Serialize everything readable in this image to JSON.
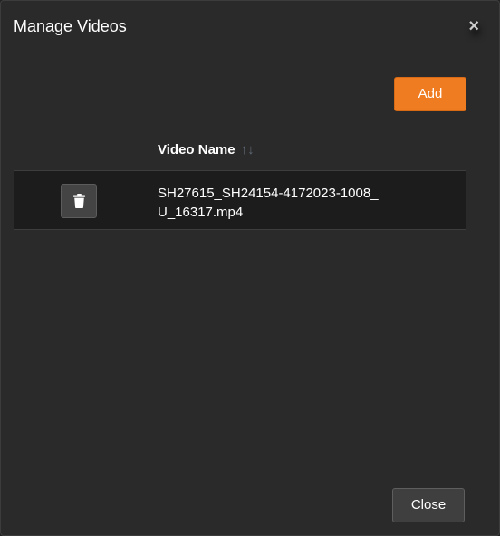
{
  "modal": {
    "title": "Manage Videos",
    "close_icon": "×"
  },
  "toolbar": {
    "add_label": "Add"
  },
  "table": {
    "columns": [
      {
        "label": "Video Name",
        "sort_icon": "↑↓"
      }
    ],
    "rows": [
      {
        "video_name": "SH27615_SH24154-4172023-1008_U_16317.mp4",
        "action_icon": "trash-icon"
      }
    ]
  },
  "footer": {
    "close_label": "Close"
  },
  "colors": {
    "background": "#2a2a2a",
    "accent": "#f07c21",
    "row_background": "#1c1c1c",
    "button_background": "#3f3f3f"
  }
}
